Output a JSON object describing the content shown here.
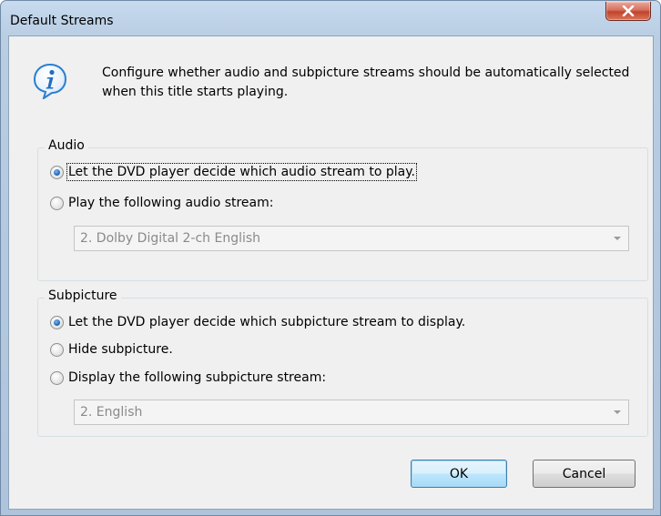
{
  "window": {
    "title": "Default Streams"
  },
  "info": {
    "text": "Configure whether audio and subpicture streams should be automatically selected when this title starts playing."
  },
  "audio": {
    "group_label": "Audio",
    "options": [
      {
        "label": "Let the DVD player decide which audio stream to play.",
        "checked": true
      },
      {
        "label": "Play the following audio stream:",
        "checked": false
      }
    ],
    "stream_select": {
      "value": "2. Dolby Digital 2-ch English",
      "enabled": false
    }
  },
  "subpicture": {
    "group_label": "Subpicture",
    "options": [
      {
        "label": "Let the DVD player decide which subpicture stream to display.",
        "checked": true
      },
      {
        "label": "Hide subpicture.",
        "checked": false
      },
      {
        "label": "Display the following subpicture stream:",
        "checked": false
      }
    ],
    "stream_select": {
      "value": "2. English",
      "enabled": false
    }
  },
  "buttons": {
    "ok": "OK",
    "cancel": "Cancel"
  },
  "icons": {
    "info": "info-icon",
    "close": "close-icon"
  },
  "colors": {
    "close_button": "#c7432c",
    "info_icon": "#2b7fd0",
    "default_button_border": "#3c7fb1"
  }
}
